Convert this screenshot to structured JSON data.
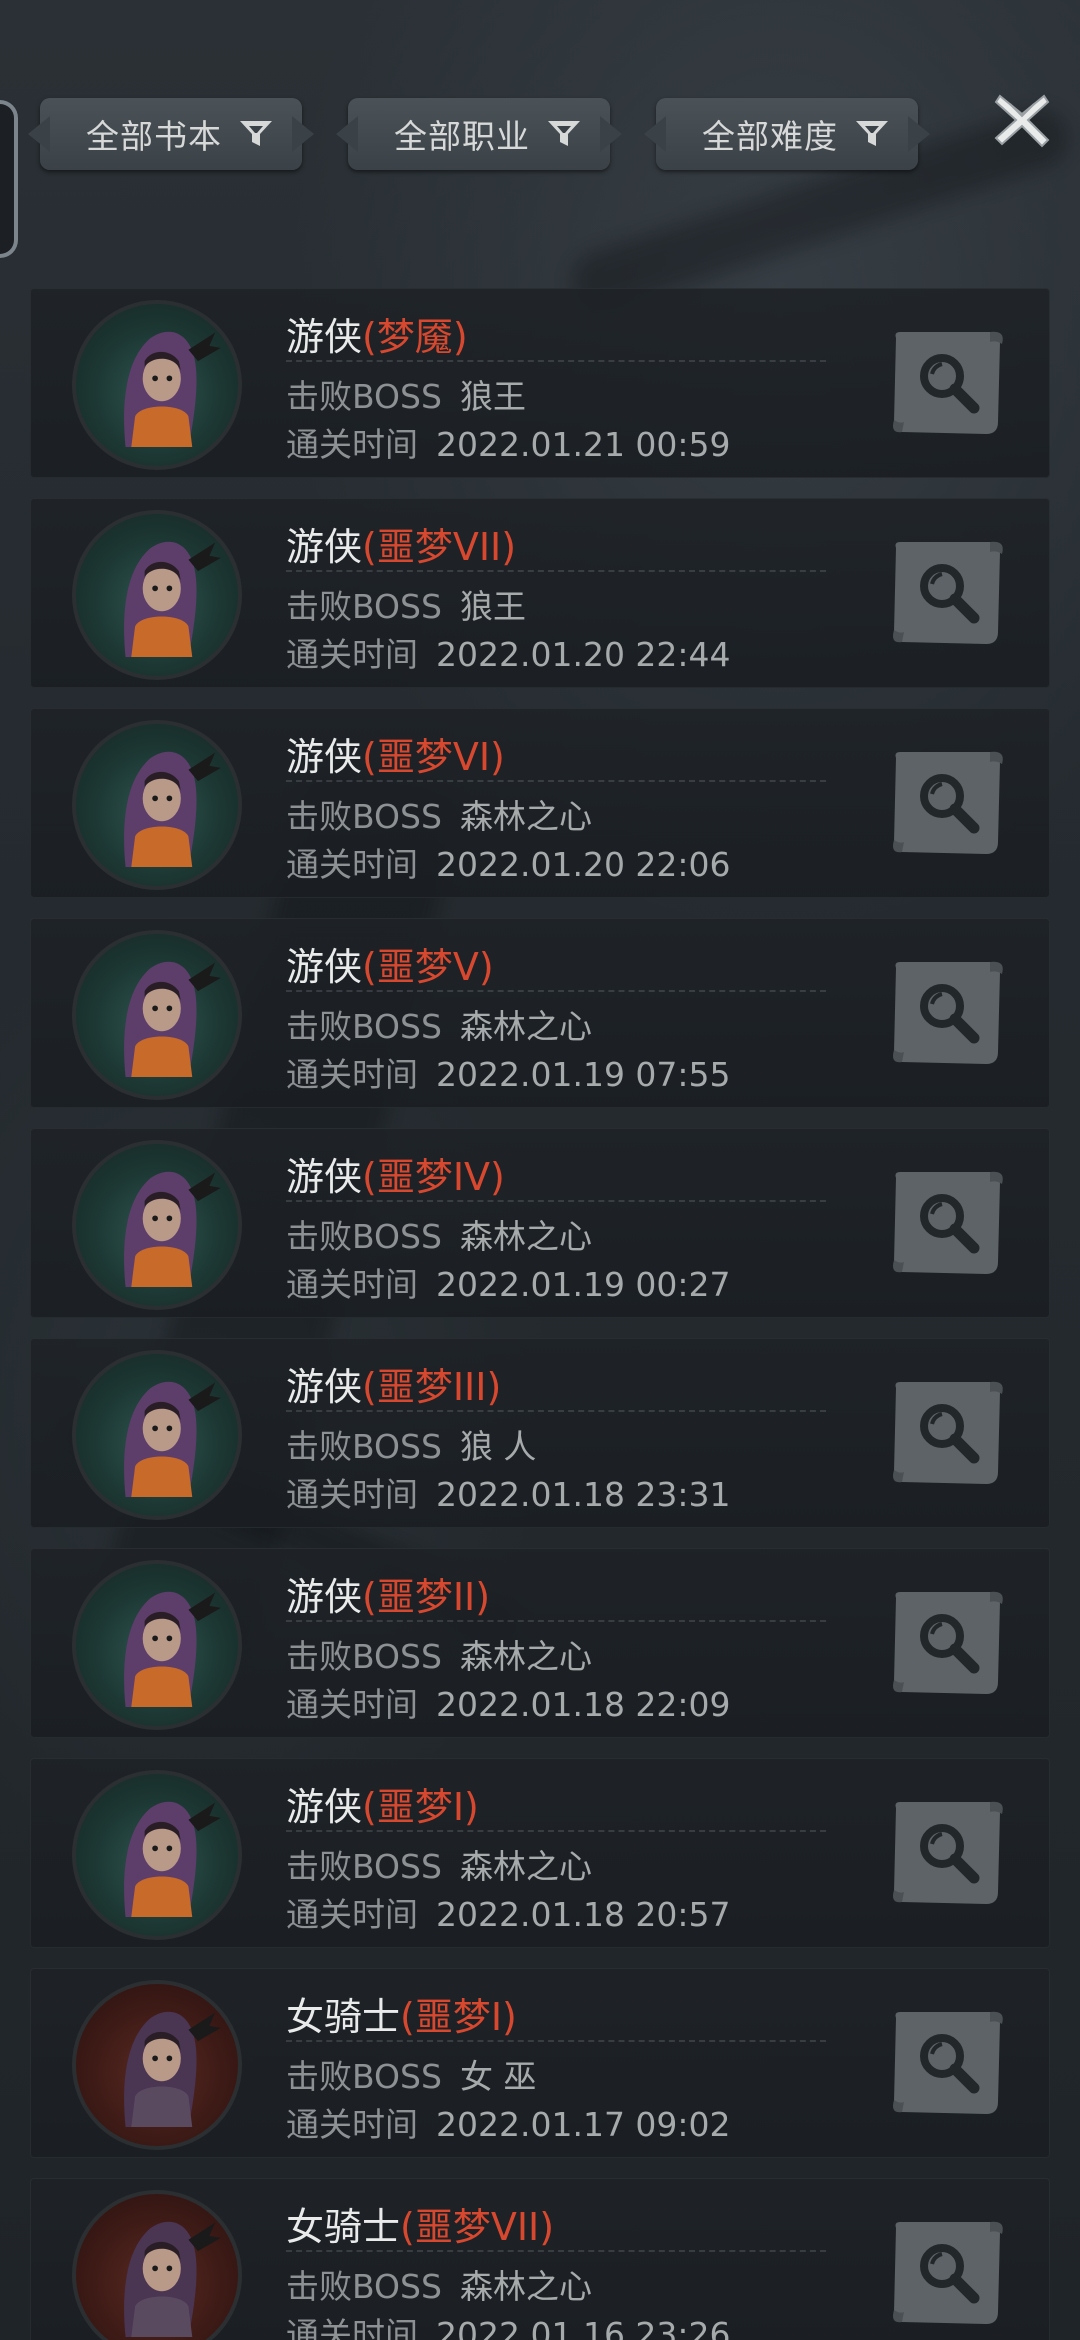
{
  "filters": [
    {
      "label": "全部书本",
      "icon": "filter-funnel-icon"
    },
    {
      "label": "全部职业",
      "icon": "filter-funnel-icon"
    },
    {
      "label": "全部难度",
      "icon": "filter-funnel-icon"
    }
  ],
  "close_icon": "close-x-icon",
  "labels": {
    "boss": "击败BOSS",
    "time": "通关时间"
  },
  "colors": {
    "difficulty": "#d8482f",
    "text": "#e9eaea",
    "muted": "#8d9194"
  },
  "records": [
    {
      "class": "游侠",
      "difficulty": "(梦魇)",
      "boss": "狼王",
      "time": "2022.01.21 00:59",
      "avatar": "ranger"
    },
    {
      "class": "游侠",
      "difficulty": "(噩梦VII)",
      "boss": "狼王",
      "time": "2022.01.20 22:44",
      "avatar": "ranger"
    },
    {
      "class": "游侠",
      "difficulty": "(噩梦VI)",
      "boss": "森林之心",
      "time": "2022.01.20 22:06",
      "avatar": "ranger"
    },
    {
      "class": "游侠",
      "difficulty": "(噩梦V)",
      "boss": "森林之心",
      "time": "2022.01.19 07:55",
      "avatar": "ranger"
    },
    {
      "class": "游侠",
      "difficulty": "(噩梦IV)",
      "boss": "森林之心",
      "time": "2022.01.19 00:27",
      "avatar": "ranger"
    },
    {
      "class": "游侠",
      "difficulty": "(噩梦III)",
      "boss": "狼 人",
      "time": "2022.01.18 23:31",
      "avatar": "ranger"
    },
    {
      "class": "游侠",
      "difficulty": "(噩梦II)",
      "boss": "森林之心",
      "time": "2022.01.18 22:09",
      "avatar": "ranger"
    },
    {
      "class": "游侠",
      "difficulty": "(噩梦I)",
      "boss": "森林之心",
      "time": "2022.01.18 20:57",
      "avatar": "ranger"
    },
    {
      "class": "女骑士",
      "difficulty": "(噩梦I)",
      "boss": "女 巫",
      "time": "2022.01.17 09:02",
      "avatar": "knight"
    },
    {
      "class": "女骑士",
      "difficulty": "(噩梦VII)",
      "boss": "森林之心",
      "time": "2022.01.16 23:26",
      "avatar": "knight"
    }
  ]
}
